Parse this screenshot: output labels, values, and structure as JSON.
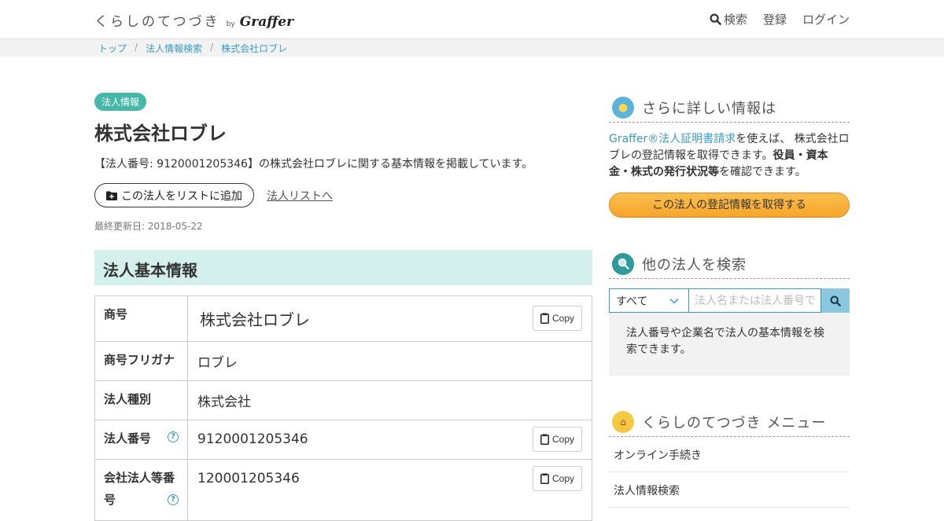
{
  "header": {
    "logo_main": "くらしのてつづき",
    "logo_by": "by",
    "logo_brand": "Graffer",
    "nav": [
      {
        "label": "検索",
        "icon": "search-icon"
      },
      {
        "label": "登録"
      },
      {
        "label": "ログイン"
      }
    ]
  },
  "breadcrumb": [
    "トップ",
    "法人情報検索",
    "株式会社ロブレ"
  ],
  "main": {
    "badge": "法人情報",
    "title": "株式会社ロブレ",
    "description": "【法人番号: 9120001205346】の株式会社ロブレに関する基本情報を掲載しています。",
    "add_button": "この法人をリストに追加",
    "list_link": "法人リストへ",
    "updated": "最終更新日: 2018-05-22",
    "section_title": "法人基本情報",
    "copy_label": "Copy",
    "rows": [
      {
        "key": "商号",
        "value": "株式会社ロブレ"
      },
      {
        "key": "商号フリガナ",
        "value": "ロブレ"
      },
      {
        "key": "法人種別",
        "value": "株式会社"
      },
      {
        "key": "法人番号",
        "value": "9120001205346"
      },
      {
        "key": "会社法人等番号",
        "value": "120001205346"
      }
    ]
  },
  "side": {
    "more_title": "さらに詳しい情報は",
    "more_link": "Graffer®法人証明書請求",
    "more_text_1": "を使えば、 株式会社ロブレの登記情報を取得できます。",
    "more_bold": "役員・資本金・株式の発行状況等",
    "more_text_2": "を確認できます。",
    "cta": "この法人の登記情報を取得する",
    "search_title": "他の法人を検索",
    "search_select": "すべて",
    "search_placeholder": "法人名または法人番号で検索",
    "search_note": "法人番号や企業名で法人の基本情報を検索できます。",
    "menu_title": "くらしのてつづき メニュー",
    "menu_items": [
      "オンライン手続き",
      "法人情報検索"
    ]
  },
  "colors": {
    "accent": "#46b8a9",
    "link": "#3b9bc4",
    "section_bg": "#d3f0ec",
    "cta": "#f7a52a"
  }
}
